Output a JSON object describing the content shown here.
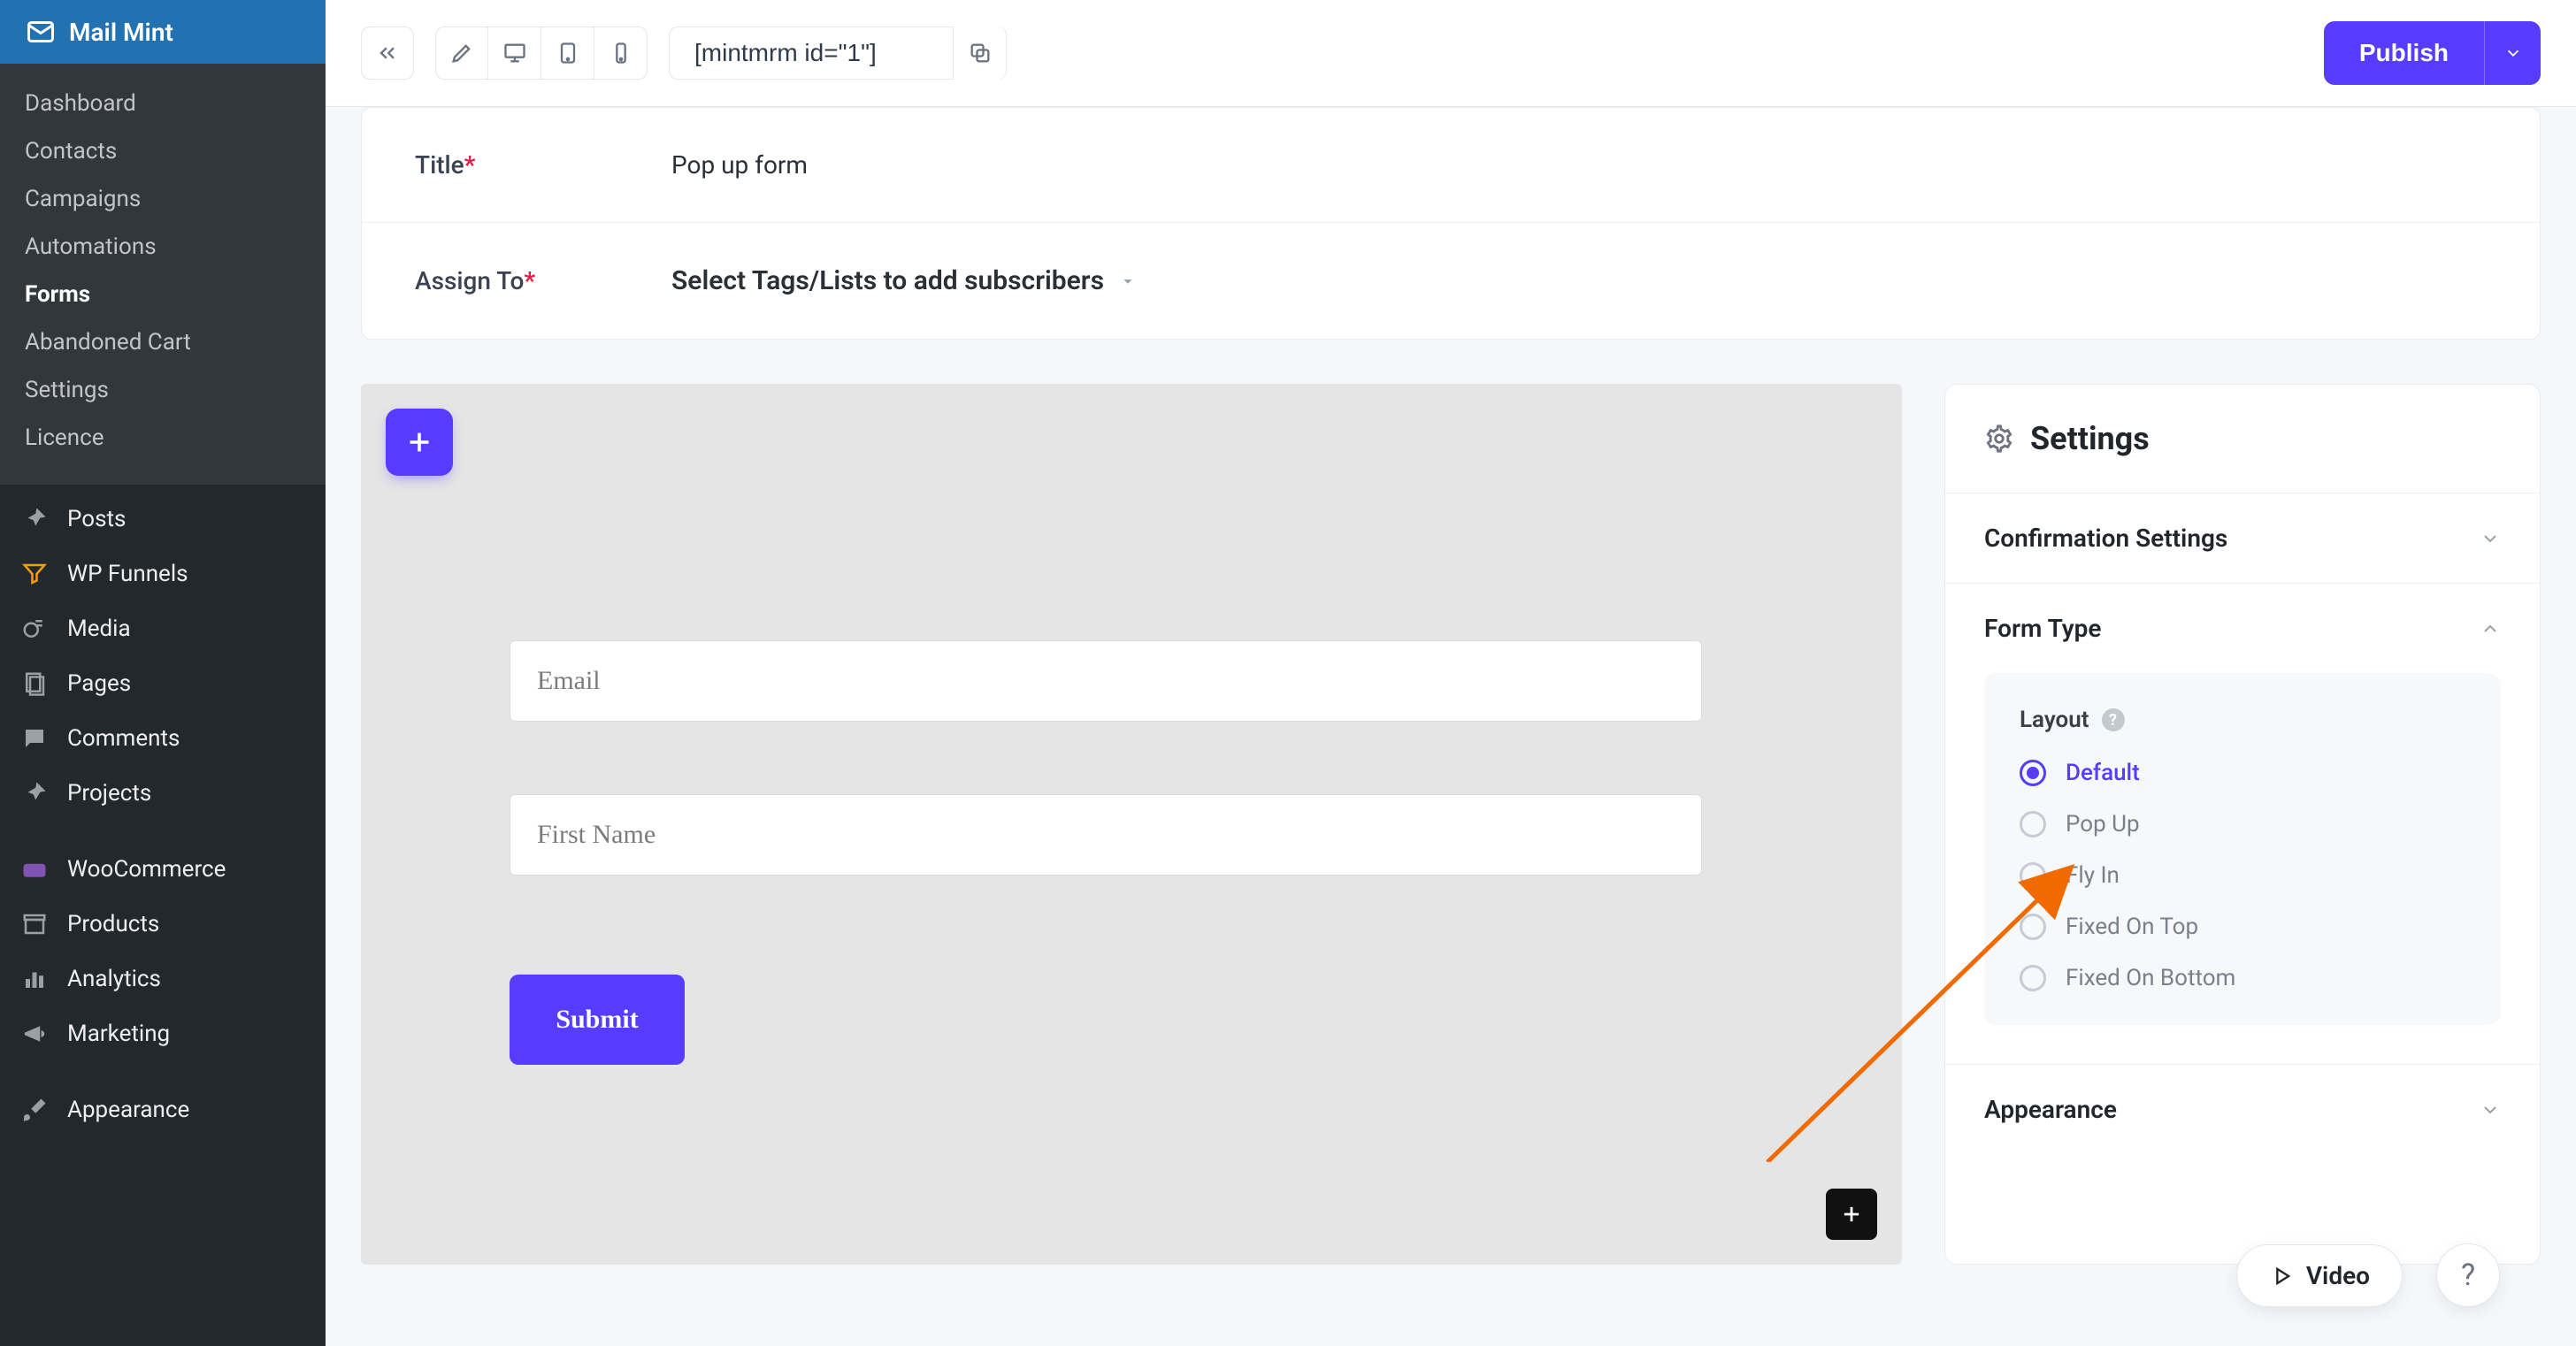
{
  "brand": "Mail Mint",
  "sidebar": {
    "primary": [
      {
        "label": "Dashboard"
      },
      {
        "label": "Contacts"
      },
      {
        "label": "Campaigns"
      },
      {
        "label": "Automations"
      },
      {
        "label": "Forms",
        "active": true
      },
      {
        "label": "Abandoned Cart"
      },
      {
        "label": "Settings"
      },
      {
        "label": "Licence"
      }
    ],
    "secondary": [
      {
        "label": "Posts",
        "icon": "pin"
      },
      {
        "label": "WP Funnels",
        "icon": "funnel"
      },
      {
        "label": "Media",
        "icon": "media"
      },
      {
        "label": "Pages",
        "icon": "page"
      },
      {
        "label": "Comments",
        "icon": "comment"
      },
      {
        "label": "Projects",
        "icon": "pin"
      }
    ],
    "secondary2": [
      {
        "label": "WooCommerce",
        "icon": "woo"
      },
      {
        "label": "Products",
        "icon": "archive"
      },
      {
        "label": "Analytics",
        "icon": "bars"
      },
      {
        "label": "Marketing",
        "icon": "megaphone"
      }
    ],
    "secondary3": [
      {
        "label": "Appearance",
        "icon": "brush"
      }
    ]
  },
  "topbar": {
    "shortcode": "[mintmrm id=\"1\"]",
    "publish": "Publish"
  },
  "fields": {
    "title_label": "Title",
    "title_value": "Pop up form",
    "assign_label": "Assign To",
    "assign_placeholder": "Select Tags/Lists to add subscribers"
  },
  "form": {
    "email_placeholder": "Email",
    "firstname_placeholder": "First Name",
    "submit_label": "Submit"
  },
  "inspector": {
    "title": "Settings",
    "sections": {
      "confirmation": "Confirmation Settings",
      "form_type": "Form Type",
      "appearance": "Appearance"
    },
    "layout_label": "Layout",
    "layout_options": [
      {
        "label": "Default",
        "selected": true
      },
      {
        "label": "Pop Up"
      },
      {
        "label": "Fly In"
      },
      {
        "label": "Fixed On Top"
      },
      {
        "label": "Fixed On Bottom"
      }
    ]
  },
  "floating": {
    "video": "Video",
    "help": "?"
  }
}
